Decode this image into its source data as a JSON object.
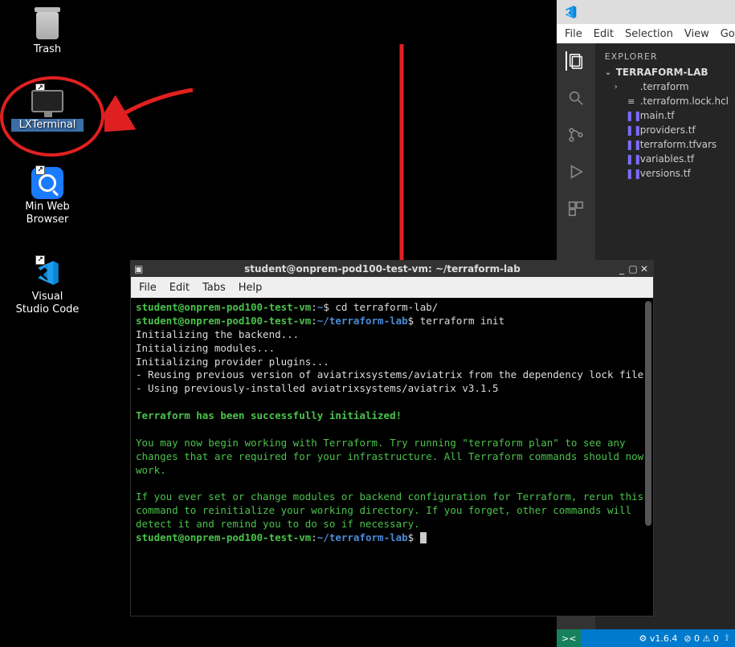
{
  "desktop": {
    "trash": "Trash",
    "lxterminal": "LXTerminal",
    "minweb": "Min Web\nBrowser",
    "vscode": "Visual\nStudio Code"
  },
  "vscode": {
    "menus": [
      "File",
      "Edit",
      "Selection",
      "View",
      "Go"
    ],
    "explorer_label": "EXPLORER",
    "project_name": "TERRAFORM-LAB",
    "tree": [
      {
        "name": ".terraform",
        "kind": "folder"
      },
      {
        "name": ".terraform.lock.hcl",
        "kind": "lock"
      },
      {
        "name": "main.tf",
        "kind": "tf"
      },
      {
        "name": "providers.tf",
        "kind": "tf"
      },
      {
        "name": "terraform.tfvars",
        "kind": "tf"
      },
      {
        "name": "variables.tf",
        "kind": "tf"
      },
      {
        "name": "versions.tf",
        "kind": "tf"
      }
    ],
    "status": {
      "version": "v1.6.4",
      "errors": "0",
      "warnings": "0"
    }
  },
  "terminal": {
    "title": "student@onprem-pod100-test-vm: ~/terraform-lab",
    "menus": [
      "File",
      "Edit",
      "Tabs",
      "Help"
    ],
    "prompt_user": "student@onprem-pod100-test-vm",
    "prompt_home": "~",
    "prompt_cwd": "~/terraform-lab",
    "cmd1": "cd terraform-lab/",
    "cmd2": "terraform init",
    "out_lines": [
      "Initializing the backend...",
      "Initializing modules...",
      "Initializing provider plugins...",
      "- Reusing previous version of aviatrixsystems/aviatrix from the dependency lock file",
      "- Using previously-installed aviatrixsystems/aviatrix v3.1.5"
    ],
    "success": "Terraform has been successfully initialized!",
    "para1": "You may now begin working with Terraform. Try running \"terraform plan\" to see any changes that are required for your infrastructure. All Terraform commands should now work.",
    "para2": "If you ever set or change modules or backend configuration for Terraform, rerun this command to reinitialize your working directory. If you forget, other commands will detect it and remind you to do so if necessary."
  }
}
